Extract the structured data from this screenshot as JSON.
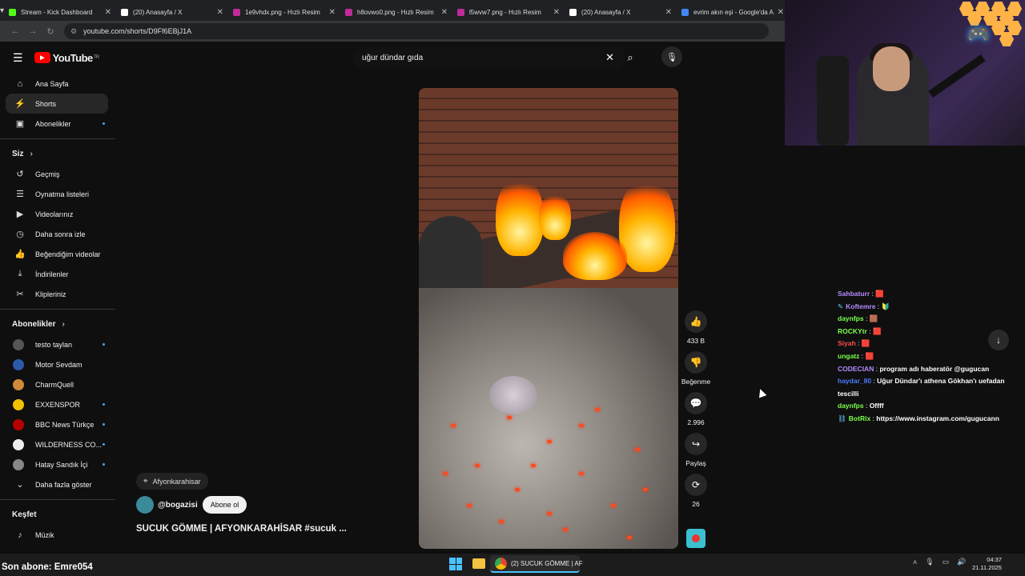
{
  "browser": {
    "tabs": [
      {
        "title": "Stream - Kick Dashboard",
        "color": "#53fc18"
      },
      {
        "title": "(20) Anasayfa / X",
        "color": "#ffffff"
      },
      {
        "title": "1e9vhdx.png - Hızlı Resim",
        "color": "#c02a9a"
      },
      {
        "title": "h8ovwo0.png - Hızlı Resim",
        "color": "#c02a9a"
      },
      {
        "title": "l5wvw7.png - Hızlı Resim",
        "color": "#c02a9a"
      },
      {
        "title": "(20) Anasayfa / X",
        "color": "#ffffff"
      },
      {
        "title": "evrim akın eşi - Google'da A",
        "color": "#4285f4"
      }
    ],
    "url": "youtube.com/shorts/D9Ff6EBjJ1A"
  },
  "youtube": {
    "logo_text": "YouTube",
    "region": "TR",
    "search_query": "uğur dündar gıda",
    "nav": [
      {
        "label": "Ana Sayfa",
        "icon": "home-icon",
        "glyph": "⌂",
        "active": false
      },
      {
        "label": "Shorts",
        "icon": "shorts-icon",
        "glyph": "⚡",
        "active": true
      },
      {
        "label": "Abonelikler",
        "icon": "subscriptions-icon",
        "glyph": "▣",
        "active": false,
        "dot": true
      }
    ],
    "you_section": "Siz",
    "you_items": [
      {
        "label": "Geçmiş",
        "icon": "history-icon",
        "glyph": "↺"
      },
      {
        "label": "Oynatma listeleri",
        "icon": "playlists-icon",
        "glyph": "☰"
      },
      {
        "label": "Videolarınız",
        "icon": "your-videos-icon",
        "glyph": "▶"
      },
      {
        "label": "Daha sonra izle",
        "icon": "watch-later-icon",
        "glyph": "◷"
      },
      {
        "label": "Beğendiğim videolar",
        "icon": "liked-icon",
        "glyph": "👍"
      },
      {
        "label": "İndirilenler",
        "icon": "downloads-icon",
        "glyph": "⤓"
      },
      {
        "label": "Klipleriniz",
        "icon": "clips-icon",
        "glyph": "✂"
      }
    ],
    "subs_section": "Abonelikler",
    "subs": [
      {
        "label": "testo taylan",
        "color": "#555",
        "dot": true
      },
      {
        "label": "Motor Sevdam",
        "color": "#2d5aa8",
        "dot": false
      },
      {
        "label": "CharmQuell",
        "color": "#d08a3a",
        "dot": false
      },
      {
        "label": "EXXENSPOR",
        "color": "#f2c200",
        "dot": true
      },
      {
        "label": "BBC News Türkçe",
        "color": "#b80000",
        "dot": true
      },
      {
        "label": "WILDERNESS CO...",
        "color": "#eeeeee",
        "dot": true
      },
      {
        "label": "Hatay Sandık İçi",
        "color": "#888",
        "dot": true
      }
    ],
    "show_more": "Daha fazla göster",
    "explore_section": "Keşfet",
    "explore_items": [
      {
        "label": "Müzik",
        "icon": "music-icon",
        "glyph": "♪"
      }
    ],
    "short": {
      "location": "Afyonkarahisar",
      "channel": "@bogazisi",
      "subscribe_label": "Abone ol",
      "title": "SUCUK GÖMME | AFYONKARAHİSAR #sucuk ...",
      "likes": "433 B",
      "dislike_label": "Beğenme",
      "comments": "2.996",
      "share_label": "Paylaş",
      "remix_count": "26"
    }
  },
  "chat": [
    {
      "user": "Sahbaturr",
      "color": "#b58cff",
      "text": "🟥"
    },
    {
      "user": "Koftemre",
      "color": "#b58cff",
      "text": "🔰",
      "badge": "✎"
    },
    {
      "user": "daynfps",
      "color": "#7cff4d",
      "text": "🟫"
    },
    {
      "user": "ROCKYtr",
      "color": "#7cff4d",
      "text": "🟥"
    },
    {
      "user": "Siyah",
      "color": "#ff4d4d",
      "text": "🟥"
    },
    {
      "user": "ungatz",
      "color": "#7cff4d",
      "text": "🟥"
    },
    {
      "user": "CODECIAN",
      "color": "#b58cff",
      "text": "program adı haberatör @gugucan"
    },
    {
      "user": "haydar_80",
      "color": "#4d7cff",
      "text": "Uğur Dündar'ı athena Gökhan'ı uefadan tescilli"
    },
    {
      "user": "daynfps",
      "color": "#7cff4d",
      "text": "Offff"
    },
    {
      "user": "BotRix",
      "color": "#7cff4d",
      "text": "https://www.instagram.com/gugucann",
      "badge": "⛓"
    }
  ],
  "overlay": {
    "last_sub": "Son abone: Emre054"
  },
  "taskbar": {
    "active_window": "(2) SUCUK GÖMME | AF",
    "time": "04:37",
    "date": "21.11.2025"
  }
}
